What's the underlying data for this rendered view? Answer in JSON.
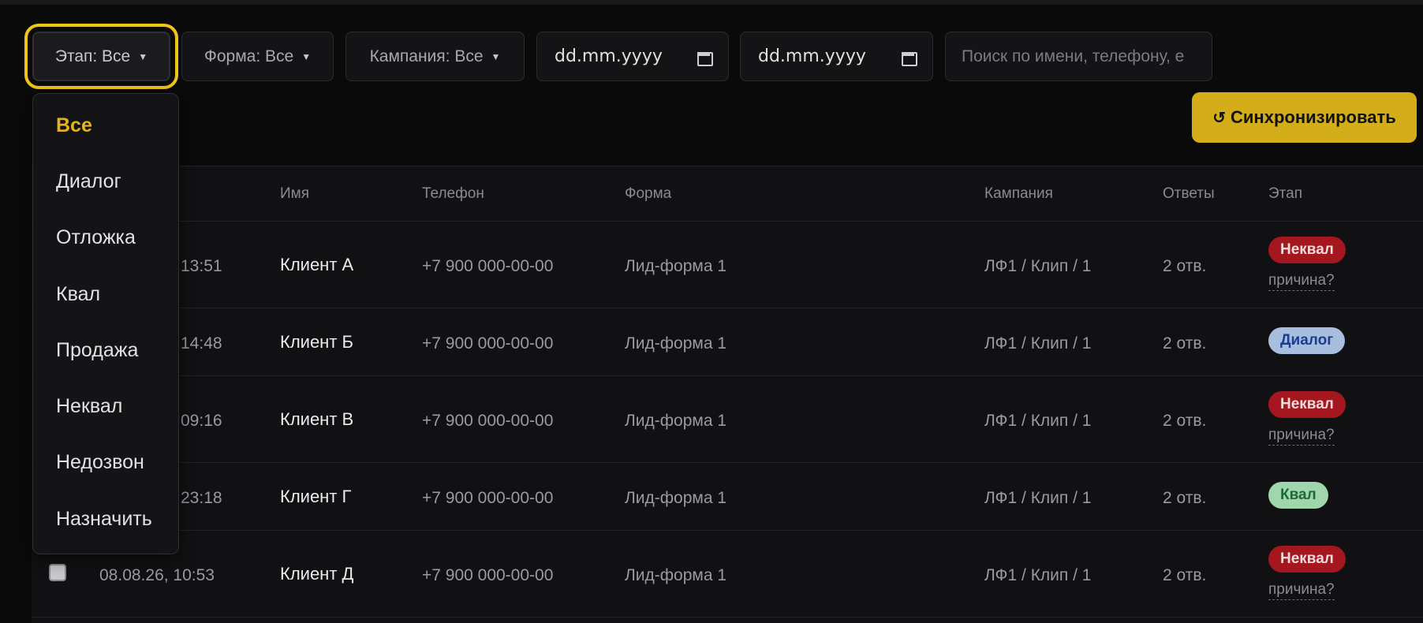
{
  "filters": {
    "stage": {
      "label": "Этап: Все",
      "caret": "▼"
    },
    "form": {
      "label": "Форма: Все",
      "caret": "▼"
    },
    "campaign": {
      "label": "Кампания: Все",
      "caret": "▼"
    },
    "date_from": {
      "value": "dd.mm.yyyy"
    },
    "date_to": {
      "value": "dd.mm.yyyy"
    },
    "search": {
      "placeholder": "Поиск по имени, телефону, e"
    }
  },
  "sync_button": {
    "icon": "↺",
    "label": "Синхронизировать"
  },
  "table": {
    "headers": {
      "name": "Имя",
      "phone": "Телефон",
      "form": "Форма",
      "campaign": "Кампания",
      "answers": "Ответы",
      "stage": "Этап"
    },
    "rows": [
      {
        "date": "13:51",
        "name": "Клиент А",
        "phone": "+7 900 000-00-00",
        "form": "Лид-форма 1",
        "campaign": "ЛФ1 / Клип / 1",
        "answers": "2 отв.",
        "stage": "Неквал",
        "reason": "причина?"
      },
      {
        "date": "14:48",
        "name": "Клиент Б",
        "phone": "+7 900 000-00-00",
        "form": "Лид-форма 1",
        "campaign": "ЛФ1 / Клип / 1",
        "answers": "2 отв.",
        "stage": "Диалог",
        "reason": ""
      },
      {
        "date": "09:16",
        "name": "Клиент В",
        "phone": "+7 900 000-00-00",
        "form": "Лид-форма 1",
        "campaign": "ЛФ1 / Клип / 1",
        "answers": "2 отв.",
        "stage": "Неквал",
        "reason": "причина?"
      },
      {
        "date": "23:18",
        "name": "Клиент Г",
        "phone": "+7 900 000-00-00",
        "form": "Лид-форма 1",
        "campaign": "ЛФ1 / Клип / 1",
        "answers": "2 отв.",
        "stage": "Квал",
        "reason": ""
      },
      {
        "date": "08.08.26, 10:53",
        "name": "Клиент Д",
        "phone": "+7 900 000-00-00",
        "form": "Лид-форма 1",
        "campaign": "ЛФ1 / Клип / 1",
        "answers": "2 отв.",
        "stage": "Неквал",
        "reason": "причина?"
      }
    ]
  },
  "dropdown": {
    "items": [
      "Все",
      "Диалог",
      "Отложка",
      "Квал",
      "Продажа",
      "Неквал",
      "Недозвон",
      "Назначить"
    ],
    "selected": "Все"
  },
  "colors": {
    "accent": "#f0c419",
    "sync": "#d4ad1a",
    "nekval": "#a4171e",
    "dialog": "#a8bedf",
    "kval": "#9fd6ab"
  }
}
